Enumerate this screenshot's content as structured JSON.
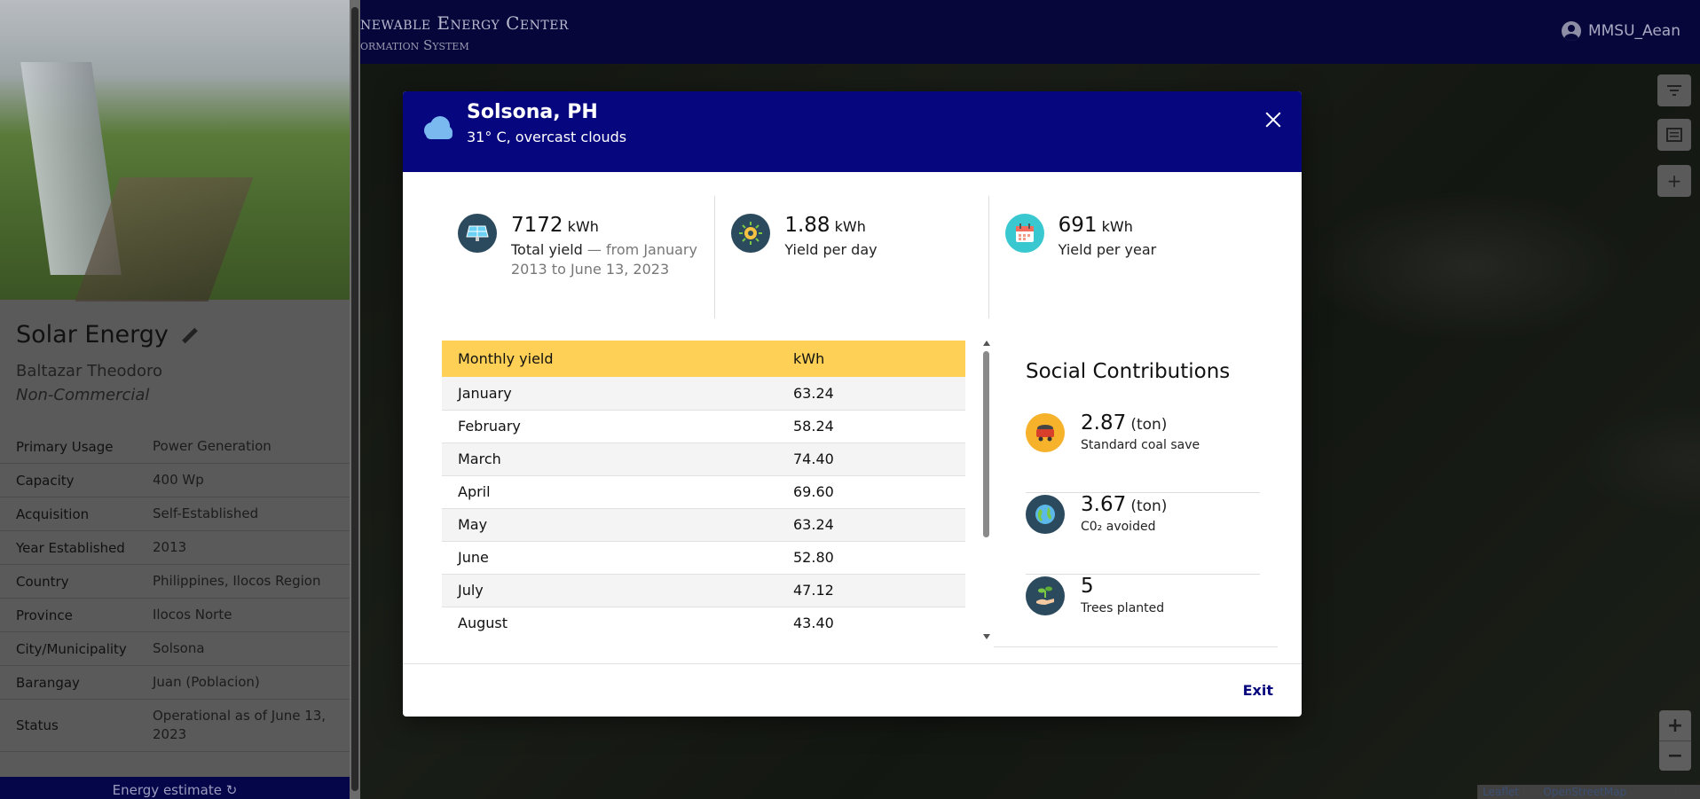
{
  "navbar": {
    "title": "newable Energy Center",
    "subtitle": "ormation System",
    "user": "MMSU_Aean"
  },
  "sidebar": {
    "title": "Solar Energy",
    "owner": "Baltazar Theodoro",
    "type": "Non-Commercial",
    "details": [
      {
        "key": "Primary Usage",
        "value": "Power Generation"
      },
      {
        "key": "Capacity",
        "value": "400 Wp"
      },
      {
        "key": "Acquisition",
        "value": "Self-Established"
      },
      {
        "key": "Year Established",
        "value": "2013"
      },
      {
        "key": "Country",
        "value": "Philippines, Ilocos Region"
      },
      {
        "key": "Province",
        "value": "Ilocos Norte"
      },
      {
        "key": "City/Municipality",
        "value": "Solsona"
      },
      {
        "key": "Barangay",
        "value": "Juan (Poblacion)"
      },
      {
        "key": "Status",
        "value": "Operational as of June 13, 2023"
      }
    ],
    "energy_button": "Energy estimate"
  },
  "modal": {
    "title": "Solsona, PH",
    "weather": "31° C, overcast clouds",
    "stats": [
      {
        "value": "7172",
        "unit": "kWh",
        "label": "Total yield",
        "detail": "— from January 2013 to June 13, 2023",
        "icon": "solar-panel-icon",
        "color": "#2c4a5e"
      },
      {
        "value": "1.88",
        "unit": "kWh",
        "label": "Yield per day",
        "detail": "",
        "icon": "sun-worker-icon",
        "color": "#2c4a5e"
      },
      {
        "value": "691",
        "unit": "kWh",
        "label": "Yield per year",
        "detail": "",
        "icon": "calendar-icon",
        "color": "#39c8d0"
      }
    ],
    "table": {
      "headers": [
        "Monthly yield",
        "kWh"
      ],
      "rows": [
        [
          "January",
          "63.24"
        ],
        [
          "February",
          "58.24"
        ],
        [
          "March",
          "74.40"
        ],
        [
          "April",
          "69.60"
        ],
        [
          "May",
          "63.24"
        ],
        [
          "June",
          "52.80"
        ],
        [
          "July",
          "47.12"
        ],
        [
          "August",
          "43.40"
        ]
      ]
    },
    "social": {
      "title": "Social Contributions",
      "items": [
        {
          "value": "2.87",
          "unit": "(ton)",
          "label": "Standard coal save",
          "icon": "coal-cart-icon",
          "color": "#f6b22b"
        },
        {
          "value": "3.67",
          "unit": "(ton)",
          "label": "C0₂ avoided",
          "icon": "globe-icon",
          "color": "#2c4a5e"
        },
        {
          "value": "5",
          "unit": "",
          "label": "Trees planted",
          "icon": "plant-hand-icon",
          "color": "#2c4a5e"
        }
      ]
    },
    "exit_label": "Exit"
  },
  "map": {
    "attribution_leaflet": "Leaflet",
    "attribution_sep": " | © ",
    "attribution_osm": "OpenStreetMap",
    "attribution_tail": " contributors"
  }
}
